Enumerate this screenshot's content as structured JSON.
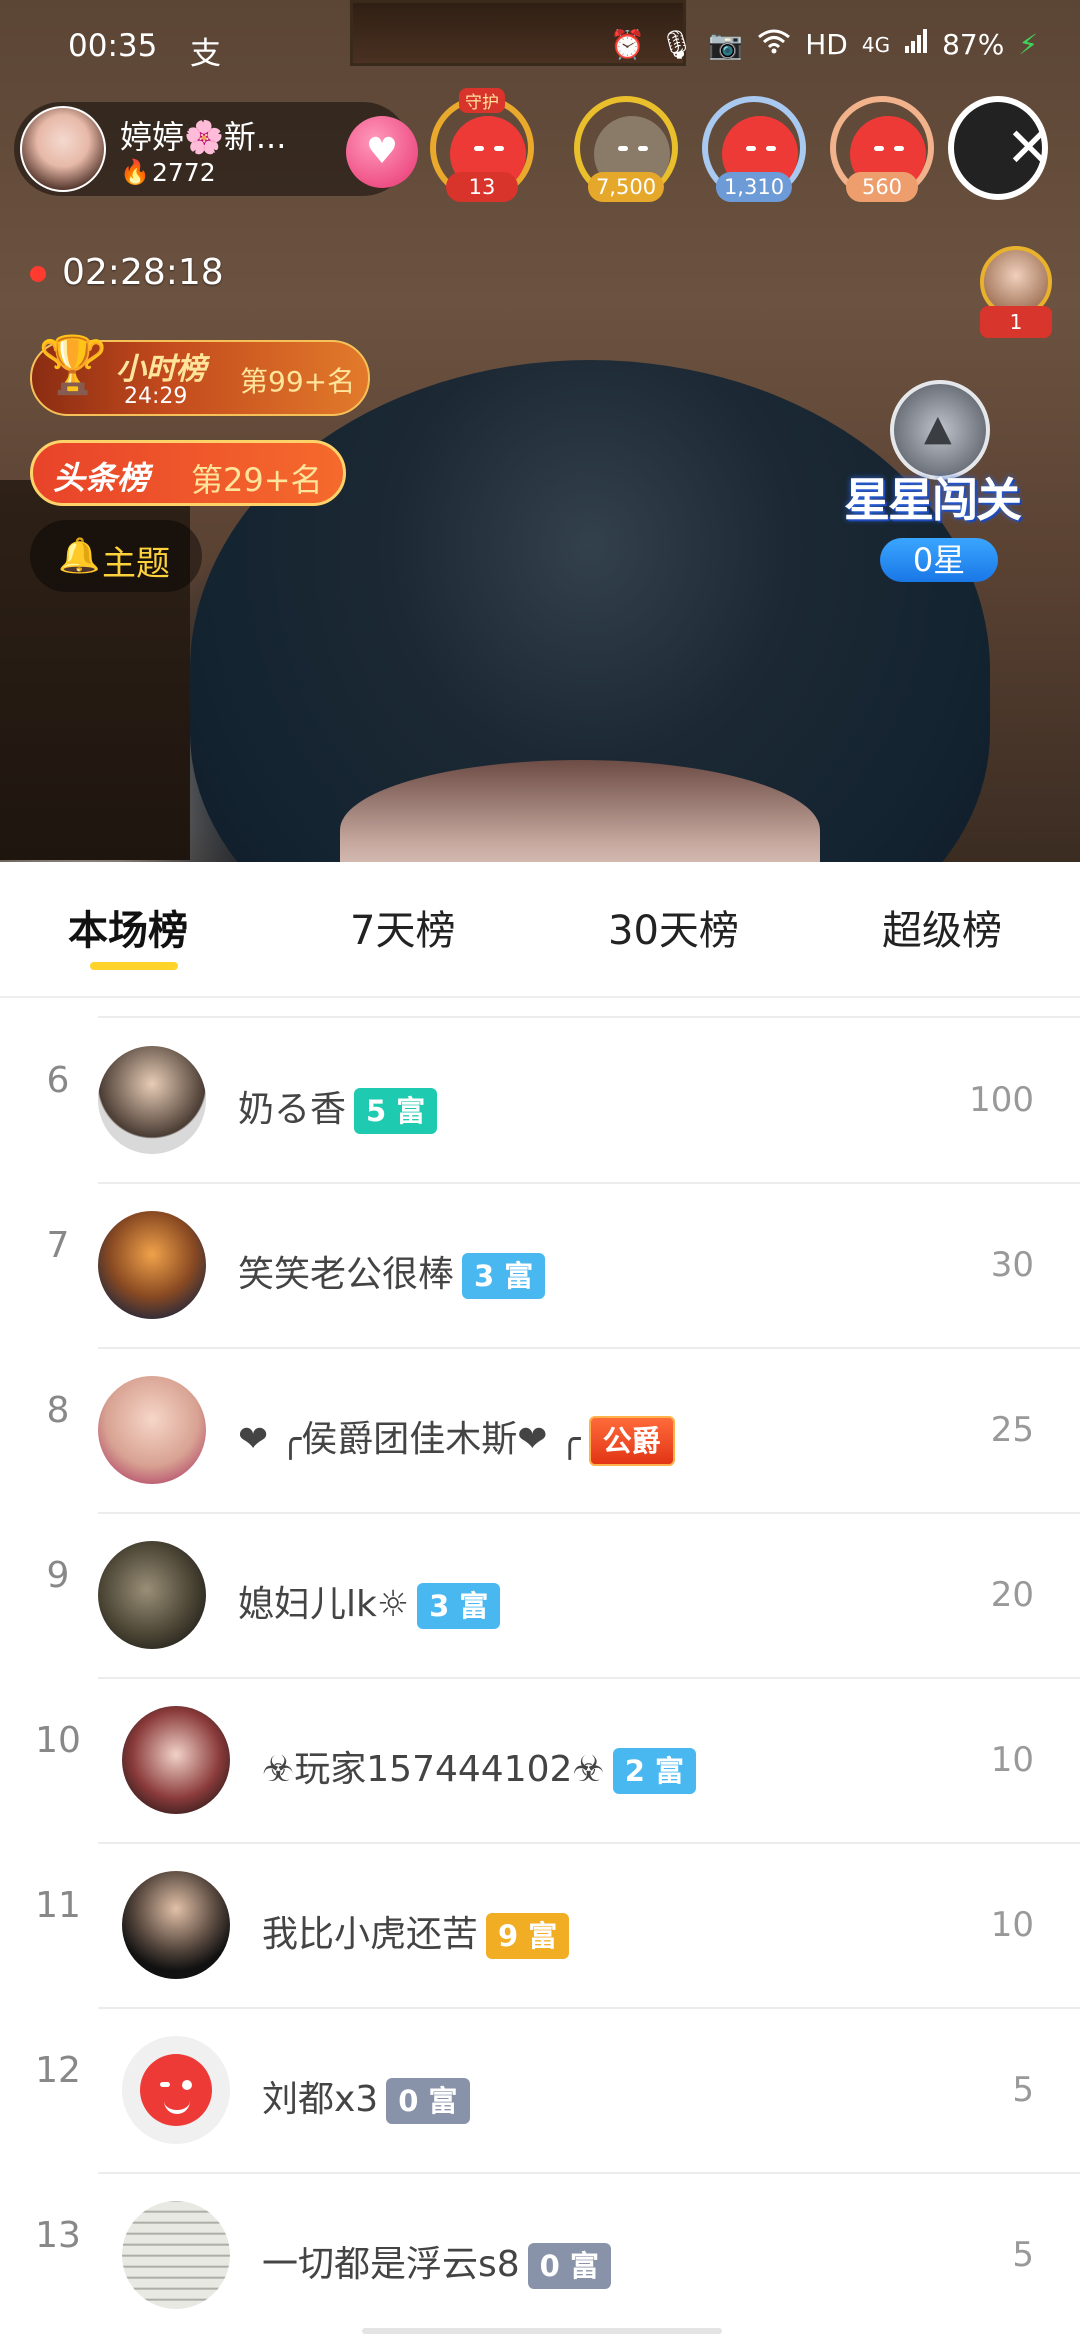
{
  "status_bar": {
    "time": "00:35",
    "left_glyph": "支",
    "right_icons": [
      "alarm-icon",
      "mic-icon",
      "camera-icon",
      "wifi-icon"
    ],
    "hd": "HD",
    "network": "4G",
    "battery": "87%"
  },
  "host": {
    "name": "婷婷🌸新...",
    "heat": "2772"
  },
  "fans": [
    {
      "crown": "守护",
      "value": "13"
    },
    {
      "value": "7,500"
    },
    {
      "value": "1,310"
    },
    {
      "value": "560"
    }
  ],
  "live": {
    "duration": "02:28:18"
  },
  "hour_rank": {
    "title": "小时榜",
    "timer": "24:29",
    "rank": "第99+名"
  },
  "headline_rank": {
    "title": "头条榜",
    "rank": "第29+名"
  },
  "topic": {
    "label": "主题"
  },
  "top_viewer": {
    "rank": "1"
  },
  "star_challenge": {
    "title": "星星闯关",
    "count": "0星"
  },
  "tabs": [
    "本场榜",
    "7天榜",
    "30天榜",
    "超级榜"
  ],
  "ranking": [
    {
      "rank": "6",
      "name": "奶る香",
      "badge": "5 富",
      "badge_color": "#1ecbb0",
      "score": "100"
    },
    {
      "rank": "7",
      "name": "笑笑老公很棒",
      "badge": "3 富",
      "badge_color": "#4ab8f0",
      "score": "30"
    },
    {
      "rank": "8",
      "name": "❤ ╭侯爵团佳木斯❤ ╭",
      "badge": "公爵",
      "badge_color": "#e23516",
      "score": "25"
    },
    {
      "rank": "9",
      "name": "媳妇儿lk☼",
      "badge": "3 富",
      "badge_color": "#4ab8f0",
      "score": "20"
    },
    {
      "rank": "10",
      "name": "☣玩家157444102☣",
      "badge": "2 富",
      "badge_color": "#4ab8f0",
      "score": "10"
    },
    {
      "rank": "11",
      "name": "我比小虎还苦",
      "badge": "9 富",
      "badge_color": "#f1ad24",
      "score": "10"
    },
    {
      "rank": "12",
      "name": "刘都x3",
      "badge": "0 富",
      "badge_color": "#8892a9",
      "score": "5"
    },
    {
      "rank": "13",
      "name": "一切都是浮云s8",
      "badge": "0 富",
      "badge_color": "#8892a9",
      "score": "5"
    }
  ]
}
